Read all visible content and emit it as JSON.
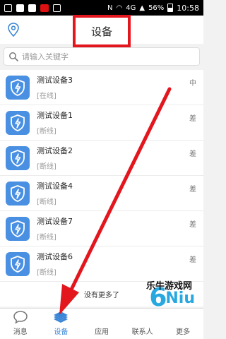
{
  "status_bar": {
    "signal": "4G",
    "battery": "56%",
    "time": "10:58"
  },
  "header": {
    "title": "设备"
  },
  "search": {
    "placeholder": "请输入关键字"
  },
  "devices": [
    {
      "name": "测试设备3",
      "status": "[在线]",
      "signal": "中"
    },
    {
      "name": "测试设备1",
      "status": "[断线]",
      "signal": "差"
    },
    {
      "name": "测试设备2",
      "status": "[断线]",
      "signal": "差"
    },
    {
      "name": "测试设备4",
      "status": "[断线]",
      "signal": "差"
    },
    {
      "name": "测试设备7",
      "status": "[断线]",
      "signal": "差"
    },
    {
      "name": "测试设备6",
      "status": "[断线]",
      "signal": "差"
    }
  ],
  "list_footer": "没有更多了",
  "tabbar": [
    {
      "label": "消息"
    },
    {
      "label": "设备"
    },
    {
      "label": "应用"
    },
    {
      "label": "联系人"
    },
    {
      "label": "更多"
    }
  ],
  "watermark": {
    "text": "乐牛游戏网"
  },
  "colors": {
    "accent": "#3b86d6",
    "highlight": "#e3161e",
    "device_icon": "#4a90e2"
  }
}
